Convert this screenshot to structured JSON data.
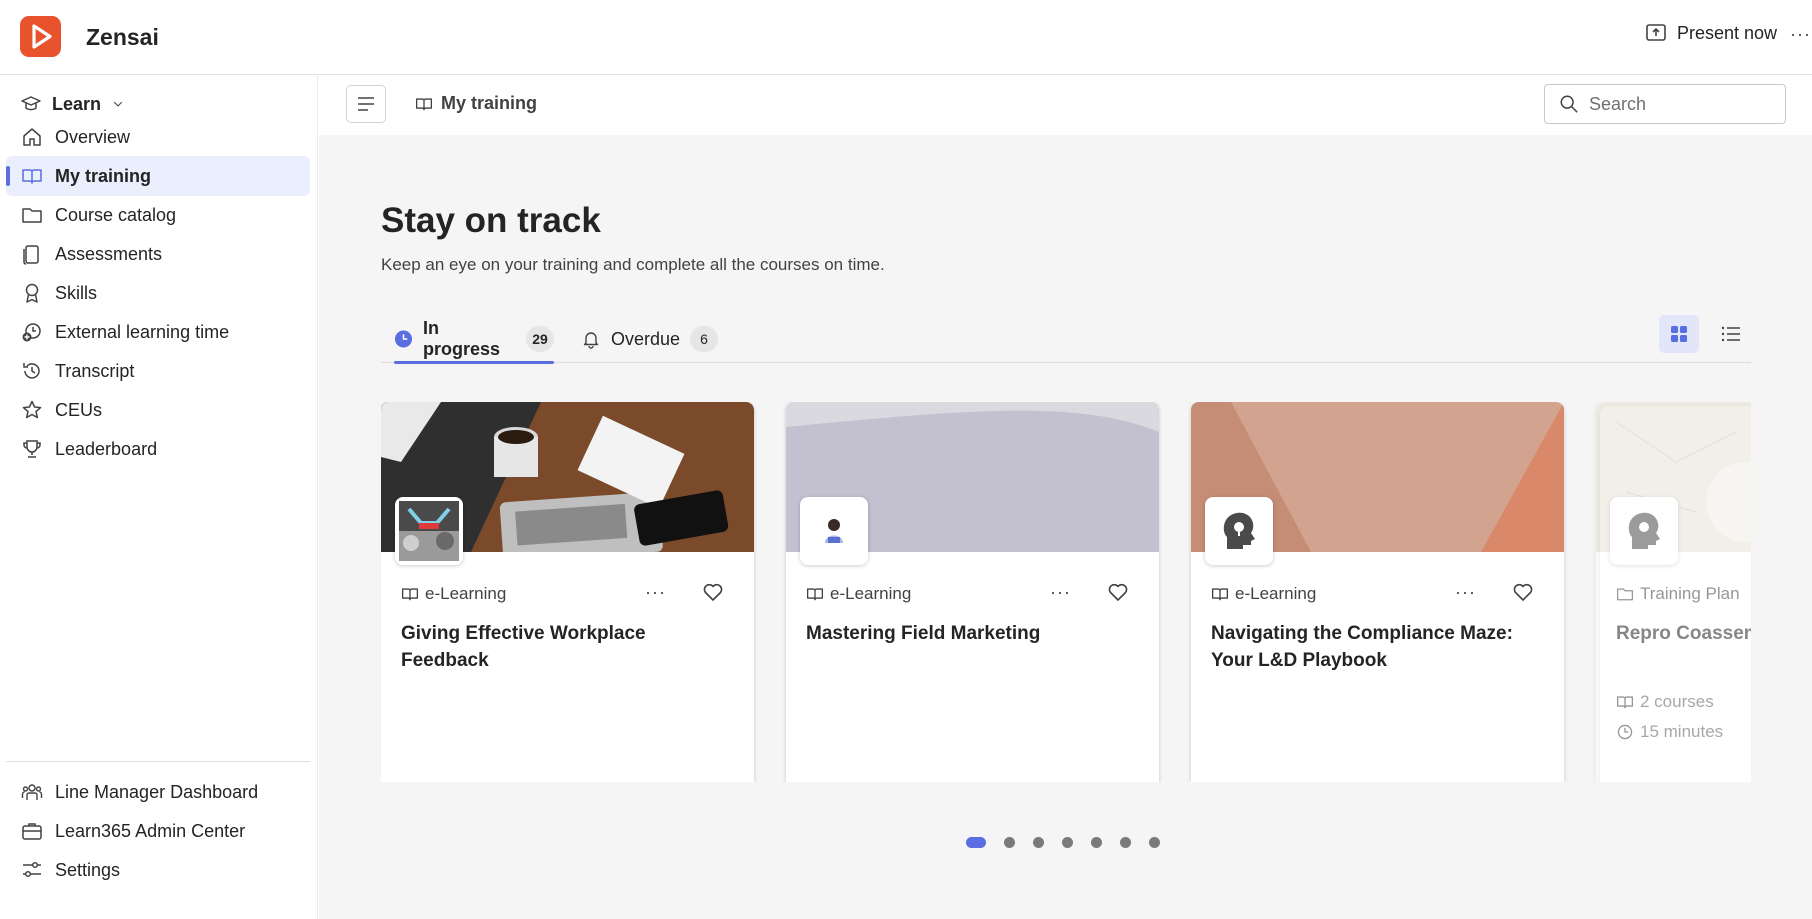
{
  "app": {
    "name": "Zensai",
    "present_label": "Present now",
    "more_label": "···"
  },
  "sidebar": {
    "switcher_label": "Learn",
    "items": [
      {
        "label": "Overview",
        "icon": "home-icon"
      },
      {
        "label": "My training",
        "icon": "book-icon",
        "active": true
      },
      {
        "label": "Course catalog",
        "icon": "folder-icon"
      },
      {
        "label": "Assessments",
        "icon": "clipboard-icon"
      },
      {
        "label": "Skills",
        "icon": "ribbon-icon"
      },
      {
        "label": "External learning time",
        "icon": "timer-add-icon"
      },
      {
        "label": "Transcript",
        "icon": "history-icon"
      },
      {
        "label": "CEUs",
        "icon": "star-icon"
      },
      {
        "label": "Leaderboard",
        "icon": "trophy-icon"
      }
    ],
    "bottom_items": [
      {
        "label": "Line Manager Dashboard",
        "icon": "people-team-icon"
      },
      {
        "label": "Learn365 Admin Center",
        "icon": "briefcase-icon"
      },
      {
        "label": "Settings",
        "icon": "settings-sliders-icon"
      }
    ]
  },
  "header": {
    "breadcrumb": "My training",
    "search_placeholder": "Search"
  },
  "main": {
    "title": "Stay on track",
    "subtitle": "Keep an eye on your training and complete all the courses on time.",
    "tabs": [
      {
        "label": "In progress",
        "count": "29",
        "active": true
      },
      {
        "label": "Overdue",
        "count": "6",
        "active": false
      }
    ],
    "cards": [
      {
        "type": "e-Learning",
        "title": "Giving Effective Workplace Feedback"
      },
      {
        "type": "e-Learning",
        "title": "Mastering Field Marketing"
      },
      {
        "type": "e-Learning",
        "title": "Navigating the Compliance Maze: Your L&D Playbook"
      },
      {
        "type": "Training Plan",
        "title": "Repro Coassemble",
        "courses": "2 courses",
        "duration": "15 minutes"
      }
    ],
    "pager": {
      "total": 7,
      "active_index": 0
    }
  },
  "colors": {
    "accent": "#5b6ee1",
    "brand": "#e8532e",
    "active_bg": "#ebeefc"
  }
}
